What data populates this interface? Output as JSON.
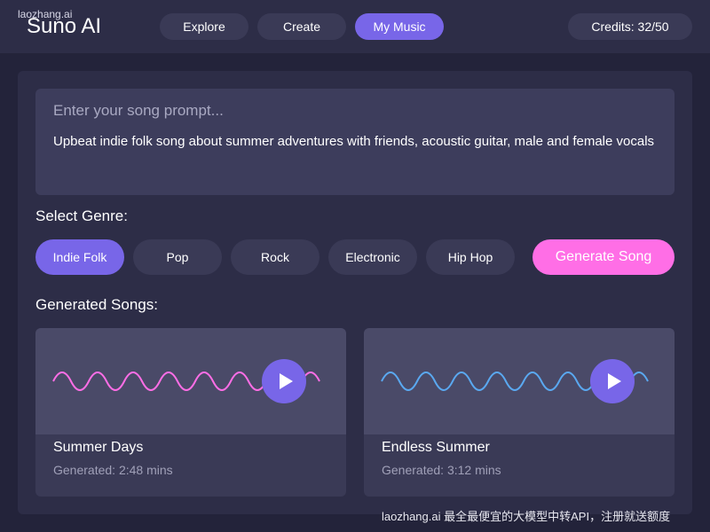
{
  "header": {
    "watermark": "laozhang.ai",
    "logo": "Suno AI",
    "nav": [
      {
        "label": "Explore",
        "active": false
      },
      {
        "label": "Create",
        "active": false
      },
      {
        "label": "My Music",
        "active": true
      }
    ],
    "credits": "Credits: 32/50"
  },
  "prompt": {
    "placeholder": "Enter your song prompt...",
    "value": "Upbeat indie folk song about summer adventures with friends, acoustic guitar, male and female vocals"
  },
  "genre": {
    "label": "Select Genre:",
    "options": [
      {
        "label": "Indie Folk",
        "selected": true
      },
      {
        "label": "Pop",
        "selected": false
      },
      {
        "label": "Rock",
        "selected": false
      },
      {
        "label": "Electronic",
        "selected": false
      },
      {
        "label": "Hip Hop",
        "selected": false
      }
    ],
    "generate_label": "Generate Song"
  },
  "songs": {
    "label": "Generated Songs:",
    "items": [
      {
        "title": "Summer Days",
        "meta": "Generated: 2:48 mins",
        "wave_color": "#ff6ee6",
        "icon": "play-icon"
      },
      {
        "title": "Endless Summer",
        "meta": "Generated: 3:12 mins",
        "wave_color": "#5aa8f0",
        "icon": "play-icon"
      }
    ]
  },
  "footer": {
    "watermark": "laozhang.ai 最全最便宜的大模型中转API，注册就送额度"
  },
  "colors": {
    "background": "#23233a",
    "surface": "#2d2d47",
    "accent": "#7866e8",
    "generate": "#ff6ee6"
  }
}
